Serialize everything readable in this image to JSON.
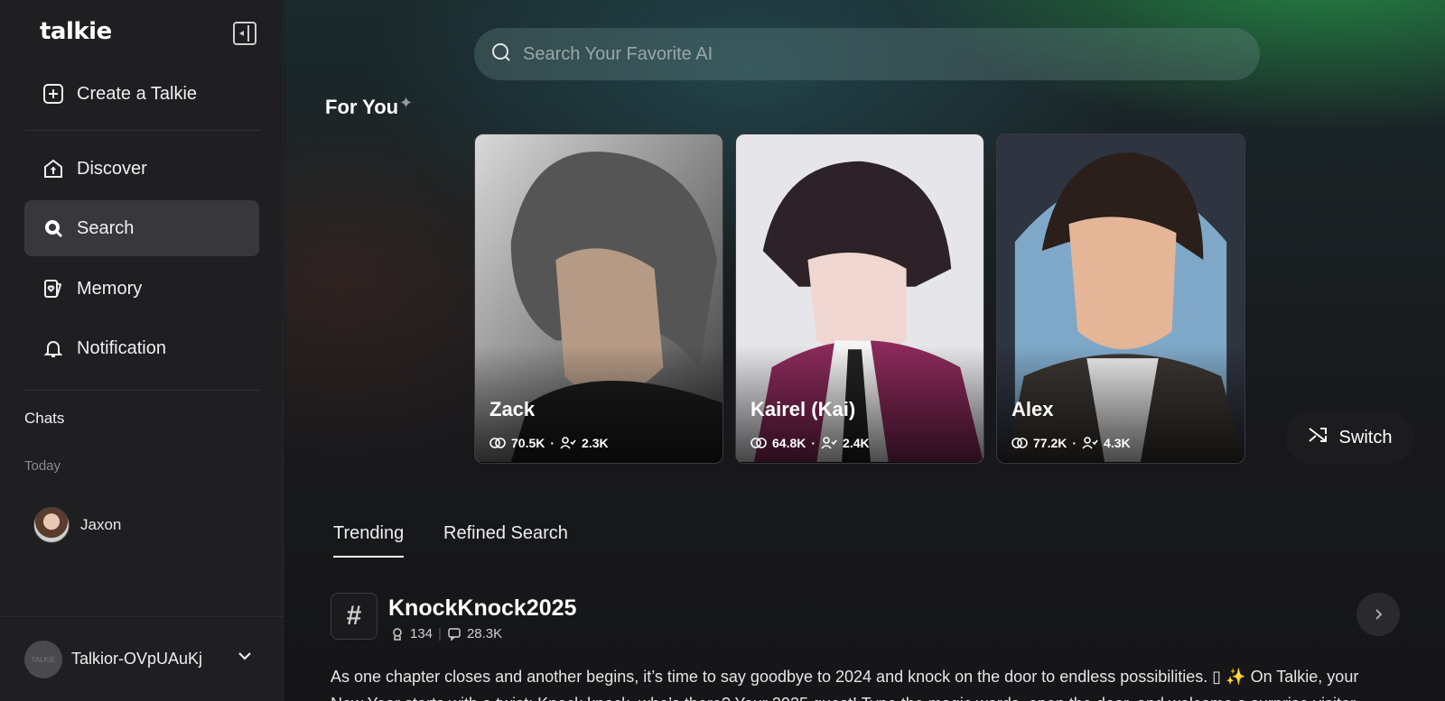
{
  "sidebar": {
    "logo": "talkie",
    "items": [
      {
        "label": "Create a Talkie",
        "icon": "plus-square-icon"
      },
      {
        "label": "Discover",
        "icon": "home-t-icon"
      },
      {
        "label": "Search",
        "icon": "search-icon",
        "active": true
      },
      {
        "label": "Memory",
        "icon": "memory-card-icon"
      },
      {
        "label": "Notification",
        "icon": "bell-icon"
      }
    ],
    "chats_title": "Chats",
    "today_label": "Today",
    "chats": [
      {
        "name": "Jaxon"
      }
    ],
    "user": {
      "name": "Talkior-OVpUAuKj",
      "avatar_text": "TALKIE"
    }
  },
  "main": {
    "search": {
      "placeholder": "Search Your Favorite AI"
    },
    "for_you_title": "For You",
    "cards": [
      {
        "name": "Zack",
        "chats": "70.5K",
        "followers": "2.3K"
      },
      {
        "name": "Kairel (Kai)",
        "chats": "64.8K",
        "followers": "2.4K"
      },
      {
        "name": "Alex",
        "chats": "77.2K",
        "followers": "4.3K"
      }
    ],
    "switch_label": "Switch",
    "tabs": [
      {
        "label": "Trending",
        "active": true
      },
      {
        "label": "Refined Search"
      }
    ],
    "topic": {
      "icon": "#",
      "title": "KnockKnock2025",
      "talkies": "134",
      "chats": "28.3K",
      "description": "As one chapter closes and another begins, it’s time to say goodbye to 2024 and knock on the door to endless possibilities. ▯ ✨ On Talkie, your New Year starts with a twist: Knock knock, who’s there? Your 2025 guest! Type the magic words, open the door, and welcome a surprise visitor."
    }
  },
  "colors": {
    "sidebar_bg": "#1f1f22",
    "active_item_bg": "#38383c",
    "accent_green": "#26964a"
  }
}
